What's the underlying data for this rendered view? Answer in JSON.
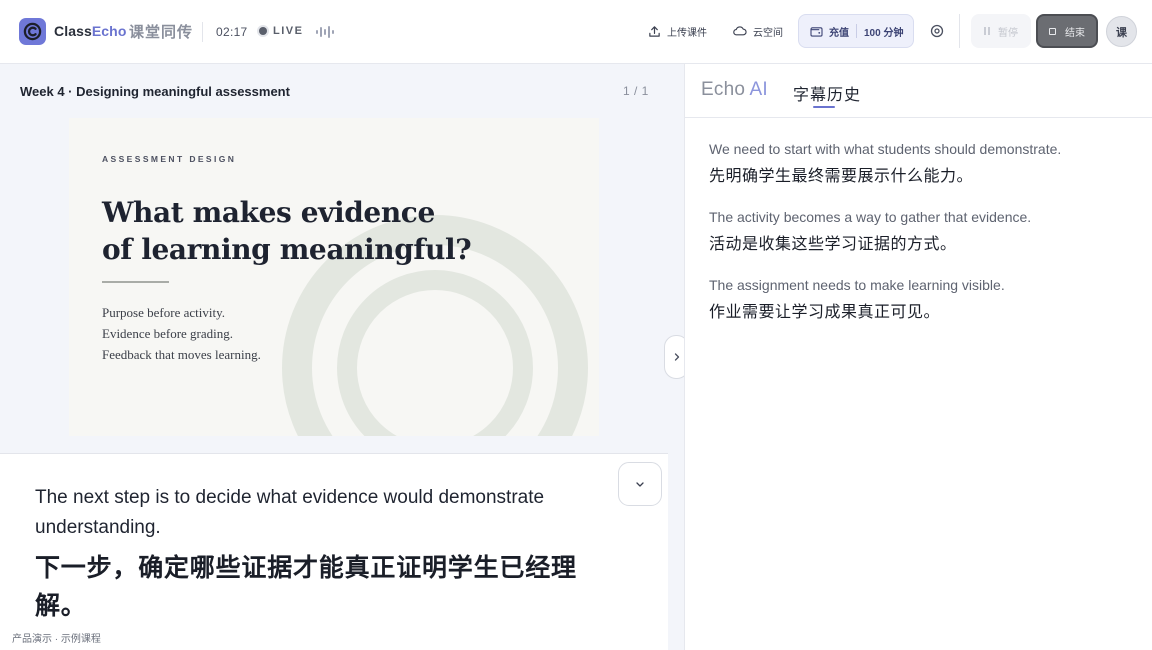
{
  "header": {
    "brand_prefix": "Class",
    "brand_suffix": "Echo",
    "brand_cn": "课堂同传",
    "timer": "02:17",
    "live_label": "LIVE",
    "upload_label": "上传课件",
    "cloud_label": "云空间",
    "recharge_label": "充值",
    "minutes_label": "100 分钟",
    "pause_label": "暂停",
    "end_label": "结束",
    "avatar_label": "课",
    "colors": {
      "accent": "#6a73cf",
      "end_button": "#6b6d72"
    }
  },
  "slide": {
    "title": "Week 4 · Designing meaningful assessment",
    "page_indicator": "1 / 1",
    "eyebrow": "ASSESSMENT DESIGN",
    "heading_line1": "What makes evidence",
    "heading_line2": "of learning meaningful?",
    "points": [
      "Purpose before activity.",
      "Evidence before grading.",
      "Feedback that moves learning."
    ]
  },
  "caption": {
    "english": "The next step is to decide what evidence would demonstrate understanding.",
    "chinese": "下一步，确定哪些证据才能真正证明学生已经理解。",
    "toggle_icon": "chevron-down-icon"
  },
  "footer": {
    "note": "产品演示 · 示例课程"
  },
  "sidebar": {
    "tab_echo_prefix": "Echo",
    "tab_echo_suffix": "AI",
    "tab_history": "字幕历史",
    "history": [
      {
        "en": "We need to start with what students should demonstrate.",
        "zh": "先明确学生最终需要展示什么能力。"
      },
      {
        "en": "The activity becomes a way to gather that evidence.",
        "zh": "活动是收集这些学习证据的方式。"
      },
      {
        "en": "The assignment needs to make learning visible.",
        "zh": "作业需要让学习成果真正可见。"
      }
    ]
  }
}
